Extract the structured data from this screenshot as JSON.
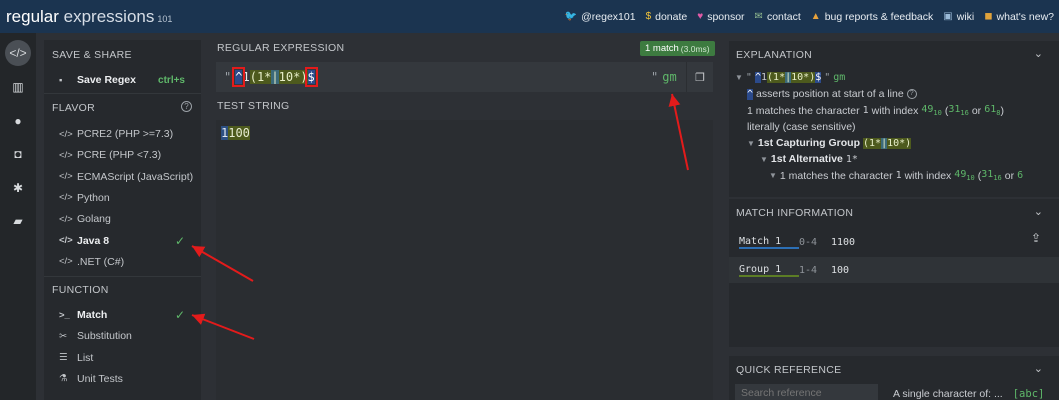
{
  "topbar": {
    "logo_main": "regular",
    "logo_light": " expressions",
    "logo_version": "101",
    "links": [
      {
        "icon": "twitter-icon",
        "glyph": "🐦",
        "label": "@regex101"
      },
      {
        "icon": "dollar-icon",
        "glyph": "$",
        "label": "donate"
      },
      {
        "icon": "heart-icon",
        "glyph": "♥",
        "label": "sponsor"
      },
      {
        "icon": "mail-icon",
        "glyph": "✉",
        "label": "contact"
      },
      {
        "icon": "warning-icon",
        "glyph": "▲",
        "label": "bug reports & feedback"
      },
      {
        "icon": "wiki-icon",
        "glyph": "▣",
        "label": "wiki"
      },
      {
        "icon": "news-icon",
        "glyph": "◼",
        "label": "what's new?"
      }
    ]
  },
  "rail": [
    "regex-editor-icon",
    "library-icon",
    "account-icon",
    "quiz-icon",
    "settings-icon",
    "chat-icon"
  ],
  "side": {
    "save_share_title": "SAVE & SHARE",
    "save_regex": "Save Regex",
    "save_shortcut": "ctrl+s",
    "flavor_title": "FLAVOR",
    "flavors": [
      {
        "label": "PCRE2 (PHP >=7.3)",
        "selected": false
      },
      {
        "label": "PCRE (PHP <7.3)",
        "selected": false
      },
      {
        "label": "ECMAScript (JavaScript)",
        "selected": false
      },
      {
        "label": "Python",
        "selected": false
      },
      {
        "label": "Golang",
        "selected": false
      },
      {
        "label": "Java 8",
        "selected": true
      },
      {
        "label": ".NET (C#)",
        "selected": false
      }
    ],
    "function_title": "FUNCTION",
    "functions": [
      {
        "label": "Match",
        "icon": "terminal-icon",
        "glyph": ">_",
        "selected": true
      },
      {
        "label": "Substitution",
        "icon": "scissors-icon",
        "glyph": "✂",
        "selected": false
      },
      {
        "label": "List",
        "icon": "list-icon",
        "glyph": "☰",
        "selected": false
      },
      {
        "label": "Unit Tests",
        "icon": "flask-icon",
        "glyph": "⚗",
        "selected": false
      }
    ]
  },
  "regex": {
    "title": "REGULAR EXPRESSION",
    "match_badge": "1 match",
    "match_time": "(3.0ms)",
    "delimiter": "\"",
    "pattern": "^1(1*|10*)$",
    "flags": "gm"
  },
  "test": {
    "title": "TEST STRING",
    "value": "1100",
    "group_part": "100"
  },
  "explanation": {
    "title": "EXPLANATION",
    "root": "^1(1*|10*)$",
    "flags": "gm",
    "anchor_token": "^",
    "anchor_text": "asserts position at start of a line",
    "match1_text_a": "1 matches the character",
    "match1_char": "1",
    "match1_text_b": "with index",
    "idx_dec": "49",
    "idx_dec_base": "10",
    "idx_hex": "31",
    "idx_hex_base": "16",
    "idx_oct": "61",
    "idx_oct_base": "8",
    "or_word": "or",
    "literal_text": "literally (case sensitive)",
    "group_label": "1st Capturing Group",
    "group_token": "(1*|10*)",
    "alt_label": "1st Alternative",
    "alt_token": "1*",
    "alt_match_text": "1 matches the character"
  },
  "match_info": {
    "title": "MATCH INFORMATION",
    "rows": [
      {
        "label": "Match 1",
        "range": "0-4",
        "value": "1100",
        "color": "#2c6fb5"
      },
      {
        "label": "Group 1",
        "range": "1-4",
        "value": "100",
        "color": "#5c7d25"
      }
    ]
  },
  "quick_ref": {
    "title": "QUICK REFERENCE",
    "search_placeholder": "Search reference",
    "item_label": "A single character of: ...",
    "item_token": "[abc]"
  }
}
